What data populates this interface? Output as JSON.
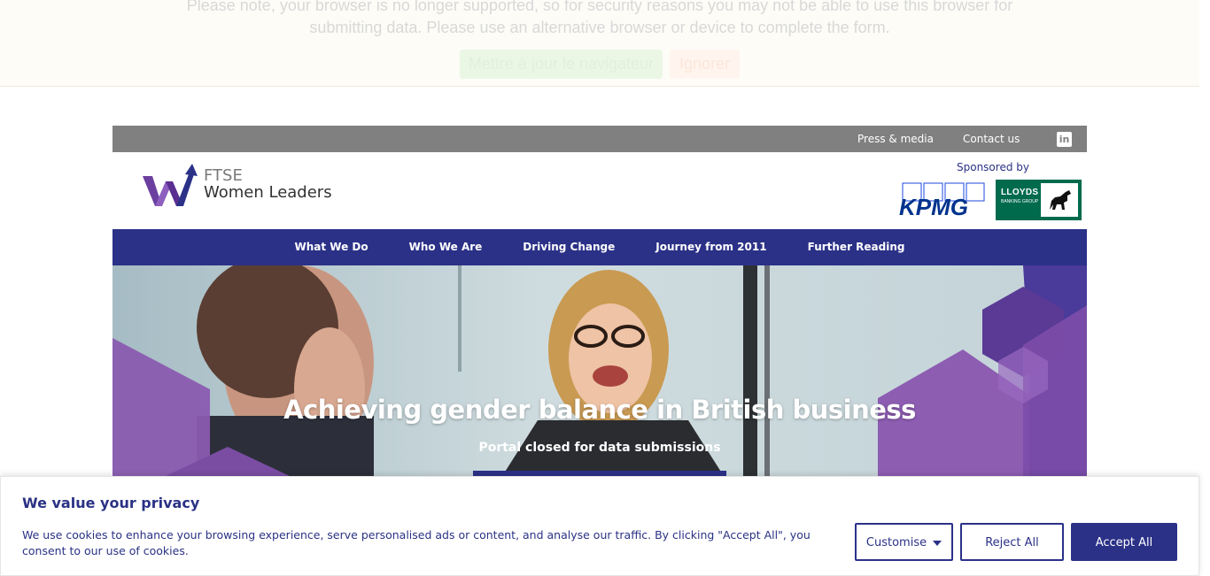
{
  "browser_notice": {
    "message": "Please note, your browser is no longer supported, so for security reasons you may not be able to use this browser for submitting data. Please use an alternative browser or device to complete the form.",
    "update_label": "Mettre à jour le navigateur",
    "ignore_label": "Ignorer"
  },
  "topbar": {
    "press_label": "Press & media",
    "contact_label": "Contact us",
    "social_icon": "linkedin-icon"
  },
  "header": {
    "logo_line1": "FTSE",
    "logo_line2": "Women Leaders",
    "sponsored_label": "Sponsored by",
    "sponsor1": "KPMG",
    "sponsor2_name": "LLOYDS",
    "sponsor2_sub": "BANKING GROUP"
  },
  "nav": {
    "items": [
      {
        "label": "What We Do"
      },
      {
        "label": "Who We Are"
      },
      {
        "label": "Driving Change"
      },
      {
        "label": "Journey from 2011"
      },
      {
        "label": "Further Reading"
      }
    ]
  },
  "hero": {
    "title": "Achieving gender balance in British business",
    "subtitle": "Portal closed for data submissions"
  },
  "cookie_banner": {
    "title": "We value your privacy",
    "text": "We use cookies to enhance your browsing experience, serve personalised ads or content, and analyse our traffic. By clicking \"Accept All\", you consent to our use of cookies.",
    "customise_label": "Customise",
    "reject_label": "Reject All",
    "accept_label": "Accept All"
  },
  "colors": {
    "brand_navy": "#2b3187",
    "brand_purple": "#7d4fa6",
    "topbar_grey": "#808080",
    "lloyds_green": "#006a4d"
  }
}
